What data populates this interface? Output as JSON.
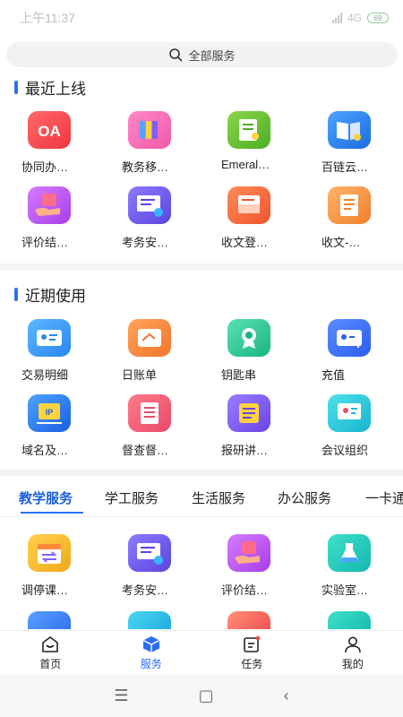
{
  "statusbar": {
    "time": "上午11:37",
    "network": "4G",
    "battery": "69"
  },
  "search": {
    "label": "全部服务"
  },
  "sections": {
    "recent_online": {
      "title": "最近上线"
    },
    "recent_used": {
      "title": "近期使用"
    }
  },
  "recent_online_items": [
    {
      "label": "协同办…",
      "icon": "oa-icon"
    },
    {
      "label": "教务移…",
      "icon": "books-icon"
    },
    {
      "label": "Emeral…",
      "icon": "document-search-icon"
    },
    {
      "label": "百链云…",
      "icon": "open-book-icon"
    },
    {
      "label": "评价结…",
      "icon": "hand-card-icon"
    },
    {
      "label": "考务安…",
      "icon": "screen-clock-icon"
    },
    {
      "label": "收文登…",
      "icon": "inbox-icon"
    },
    {
      "label": "收文-…",
      "icon": "notepad-icon"
    }
  ],
  "recent_used_items": [
    {
      "label": "交易明细",
      "icon": "id-card-icon"
    },
    {
      "label": "日账单",
      "icon": "bill-icon"
    },
    {
      "label": "钥匙串",
      "icon": "award-icon"
    },
    {
      "label": "充值",
      "icon": "card-plus-icon"
    },
    {
      "label": "域名及…",
      "icon": "ip-globe-icon"
    },
    {
      "label": "督查督…",
      "icon": "checklist-icon"
    },
    {
      "label": "报研讲…",
      "icon": "scroll-icon"
    },
    {
      "label": "会议组织",
      "icon": "meeting-icon"
    }
  ],
  "category_tabs": [
    "教学服务",
    "学工服务",
    "生活服务",
    "办公服务",
    "一卡通"
  ],
  "teaching_items": [
    {
      "label": "调停课…",
      "icon": "calendar-swap-icon"
    },
    {
      "label": "考务安…",
      "icon": "screen-clock-icon"
    },
    {
      "label": "评价结…",
      "icon": "hand-card-icon"
    },
    {
      "label": "实验室…",
      "icon": "flask-icon"
    }
  ],
  "bottom_nav": [
    {
      "label": "首页",
      "icon": "home-icon"
    },
    {
      "label": "服务",
      "icon": "cube-icon"
    },
    {
      "label": "任务",
      "icon": "task-icon"
    },
    {
      "label": "我的",
      "icon": "person-icon"
    }
  ],
  "colors": {
    "accent": "#2b6ef5",
    "tab_active": "#1a5fd8"
  }
}
